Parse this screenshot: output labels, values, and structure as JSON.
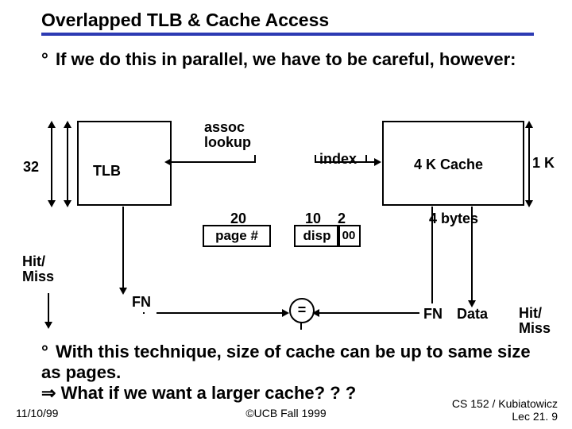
{
  "header": {
    "title": "Overlapped TLB & Cache Access"
  },
  "bullets": {
    "first_deg": "°",
    "first": "If we do this in parallel, we have to be careful, however:",
    "second_deg": "°",
    "second_l1": "With this technique, size of cache can be up to same size as pages.",
    "arrow": "⇒",
    "second_l2": "What if we want a larger cache? ? ?"
  },
  "diagram": {
    "assoc_l1": "assoc",
    "assoc_l2": "lookup",
    "index": "index",
    "bits32": "32",
    "tlb": "TLB",
    "cache": "4 K Cache",
    "k1": "1 K",
    "n20": "20",
    "n10": "10",
    "n2": "2",
    "bytes4": "4 bytes",
    "page": "page #",
    "disp": "disp",
    "zz": "00",
    "hitmiss": "Hit/\nMiss",
    "fn": "FN",
    "data": "Data",
    "eq": "="
  },
  "footer": {
    "date": "11/10/99",
    "copy": "©UCB Fall 1999",
    "course_l1": "CS 152 / Kubiatowicz",
    "course_l2": "Lec 21. 9"
  }
}
